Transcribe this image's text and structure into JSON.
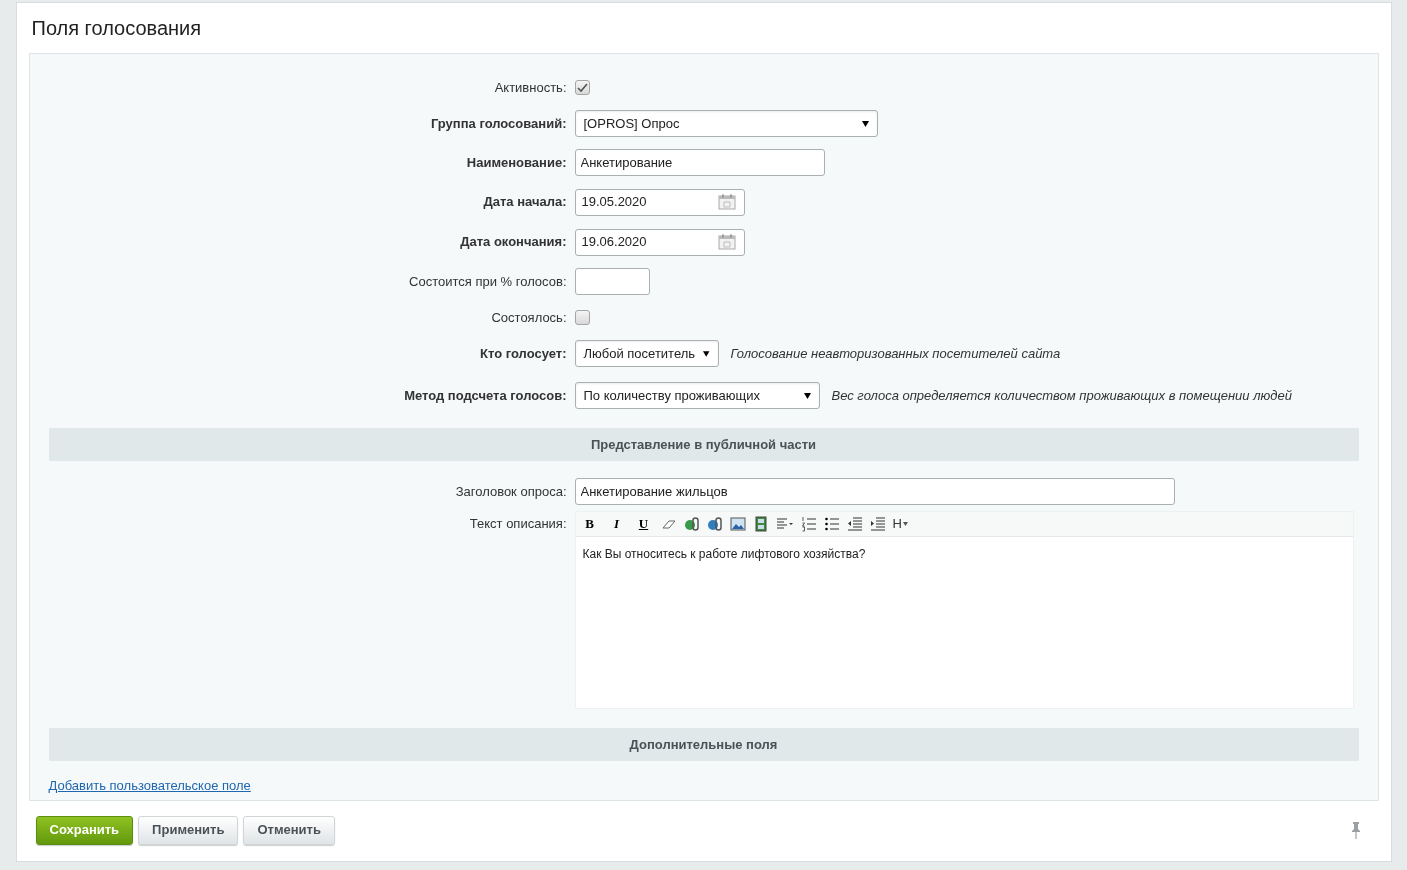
{
  "title": "Поля голосования",
  "fields": [
    {
      "kind": "checkbox",
      "label": "Активность:",
      "required": false,
      "checked": true
    },
    {
      "kind": "select",
      "label": "Группа голосований:",
      "required": true,
      "value": "[OPROS] Опрос"
    },
    {
      "kind": "text",
      "label": "Наименование:",
      "required": true,
      "value": "Анкетирование"
    },
    {
      "kind": "date",
      "label": "Дата начала:",
      "required": true,
      "value": "19.05.2020"
    },
    {
      "kind": "date",
      "label": "Дата окончания:",
      "required": true,
      "value": "19.06.2020"
    },
    {
      "kind": "text",
      "label": "Состоится при % голосов:",
      "required": false
    },
    {
      "kind": "checkbox",
      "label": "Состоялось:",
      "required": false,
      "checked": false
    },
    {
      "kind": "select",
      "label": "Кто голосует:",
      "required": true,
      "value": "Любой посетитель",
      "note": "Голосование неавторизованных посетителей сайта"
    },
    {
      "kind": "select",
      "label": "Метод подсчета голосов:",
      "required": true,
      "value": "По количеству проживающих",
      "note": "Вес голоса определяется количеством проживающих в помещении людей"
    }
  ],
  "public_section": {
    "heading": "Представление в публичной части",
    "poll_title": {
      "label": "Заголовок опроса:",
      "value": "Анкетирование жильцов"
    },
    "description": {
      "label": "Текст описания:",
      "toolbar": [
        {
          "kind": "bold",
          "label": "B"
        },
        {
          "kind": "italic",
          "label": "I"
        },
        {
          "kind": "underline",
          "label": "U"
        },
        {
          "kind": "eraser"
        },
        {
          "kind": "link"
        },
        {
          "kind": "unlink"
        },
        {
          "kind": "image"
        },
        {
          "kind": "video"
        },
        {
          "kind": "align"
        },
        {
          "kind": "ordered-list"
        },
        {
          "kind": "bullet-list"
        },
        {
          "kind": "outdent"
        },
        {
          "kind": "indent"
        },
        {
          "kind": "heading",
          "label": "H"
        }
      ],
      "text": "Как Вы относитесь к работе лифтового хозяйства?"
    }
  },
  "extra_section": {
    "heading": "Дополнительные поля",
    "link": "Добавить пользовательское поле"
  },
  "buttons": [
    {
      "label": "Сохранить",
      "kind": "primary"
    },
    {
      "label": "Применить",
      "kind": "secondary"
    },
    {
      "label": "Отменить",
      "kind": "secondary"
    }
  ]
}
